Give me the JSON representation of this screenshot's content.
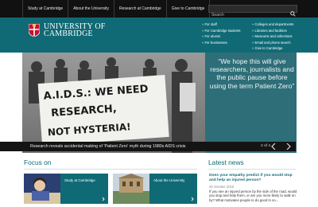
{
  "topnav": {
    "items": [
      {
        "label": "Study at Cambridge"
      },
      {
        "label": "About the University"
      },
      {
        "label": "Research at Cambridge"
      },
      {
        "label": "Give to Cambridge"
      }
    ]
  },
  "search": {
    "placeholder": "Search"
  },
  "header": {
    "logo_line1": "UNIVERSITY OF",
    "logo_line2": "CAMBRIDGE",
    "quicklinks_col1": [
      "For staff",
      "For Cambridge students",
      "For alumni",
      "For businesses"
    ],
    "quicklinks_col2": [
      "Colleges and departments",
      "Libraries and facilities",
      "Museums and collections",
      "Email and phone search",
      "Give to Cambridge"
    ]
  },
  "hero": {
    "quote": "“We hope this will give researchers, journalists and the public pause before using the term Patient Zero”",
    "caption": "Research reveals accidental making of 'Patient Zero' myth during 1980s AIDS crisis",
    "counter": "2 of 4",
    "banner_line1": "A.I.D.S.: WE NEED",
    "banner_line2": "RESEARCH,",
    "banner_line3": "NOT HYSTERIA!"
  },
  "focus": {
    "title": "Focus on",
    "cards": [
      {
        "label": "Study at Cambridge"
      },
      {
        "label": "About the University"
      }
    ]
  },
  "latest": {
    "title": "Latest news",
    "headline": "Does your empathy predict if you would stop and help an injured person?",
    "date": "25 October 2016",
    "body": "If you see an injured person by the side of the road, would you stop and help them, or are you more likely to walk on by? What motivates people to do good in so..."
  },
  "colors": {
    "teal": "#0f6a75",
    "quote_panel": "#2e6e78",
    "topbar": "#111111"
  }
}
